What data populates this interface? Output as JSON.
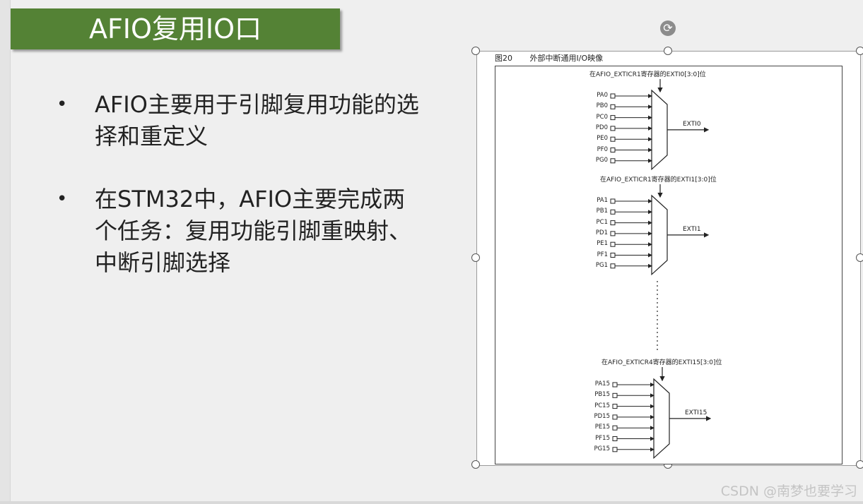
{
  "slide": {
    "title": "AFIO复用IO口",
    "bullets": [
      {
        "dot": "•",
        "text": "AFIO主要用于引脚复用功能的选择和重定义"
      },
      {
        "dot": "•",
        "text": "在STM32中，AFIO主要完成两个任务：复用功能引脚重映射、中断引脚选择"
      }
    ]
  },
  "figure": {
    "number": "图20",
    "caption": "外部中断通用I/O映像",
    "groups": [
      {
        "register_label": "在AFIO_EXTICR1寄存器的EXTI0[3:0]位",
        "pins": [
          "PA0",
          "PB0",
          "PC0",
          "PD0",
          "PE0",
          "PF0",
          "PG0"
        ],
        "output": "EXTI0"
      },
      {
        "register_label": "在AFIO_EXTICR1寄存器的EXTI1[3:0]位",
        "pins": [
          "PA1",
          "PB1",
          "PC1",
          "PD1",
          "PE1",
          "PF1",
          "PG1"
        ],
        "output": "EXTI1"
      },
      {
        "register_label": "在AFIO_EXTICR4寄存器的EXTI15[3:0]位",
        "pins": [
          "PA15",
          "PB15",
          "PC15",
          "PD15",
          "PE15",
          "PF15",
          "PG15"
        ],
        "output": "EXTI15"
      }
    ]
  },
  "icons": {
    "rotate": "rotate-icon"
  },
  "watermark": "CSDN @南梦也要学习"
}
